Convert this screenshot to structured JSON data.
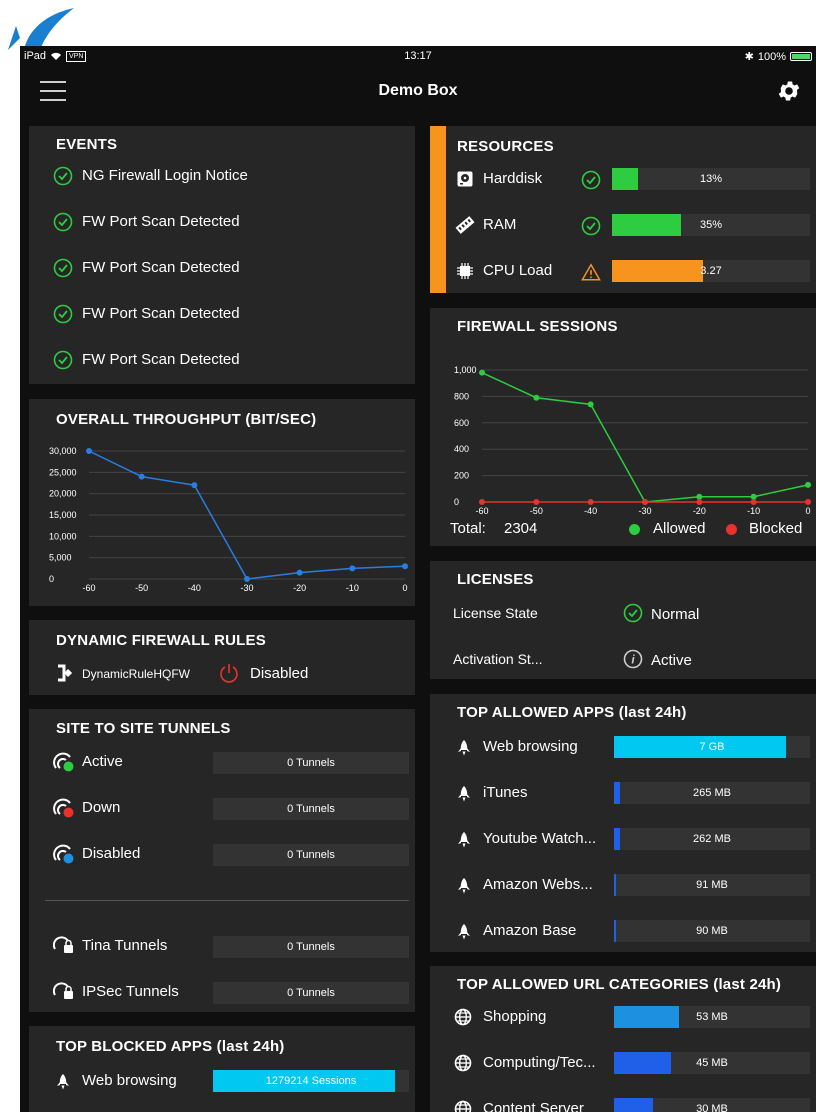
{
  "status_bar": {
    "device": "iPad",
    "vpn": "VPN",
    "time": "13:17",
    "battery": "100%"
  },
  "nav": {
    "title": "Demo Box"
  },
  "events": {
    "title": "EVENTS",
    "items": [
      "NG Firewall Login Notice",
      "FW Port Scan Detected",
      "FW Port Scan Detected",
      "FW Port Scan Detected",
      "FW Port Scan Detected"
    ]
  },
  "resources": {
    "title": "RESOURCES",
    "items": [
      {
        "label": "Harddisk",
        "value": "13%",
        "fraction": 0.13,
        "status": "ok",
        "color": "#2ecc40"
      },
      {
        "label": "RAM",
        "value": "35%",
        "fraction": 0.35,
        "status": "ok",
        "color": "#2ecc40"
      },
      {
        "label": "CPU Load",
        "value": "3.27",
        "fraction": 0.46,
        "status": "warning",
        "color": "#f7941d"
      }
    ],
    "accent_color": "#f7941d"
  },
  "throughput": {
    "title": "OVERALL THROUGHPUT (BIT/SEC)",
    "chart_data": {
      "type": "line",
      "x": [
        -60,
        -50,
        -40,
        -30,
        -20,
        -10,
        0
      ],
      "series": [
        {
          "values": [
            30000,
            24000,
            22000,
            0,
            1500,
            2500,
            3000
          ],
          "color": "#2a7de1"
        }
      ],
      "y_ticks": [
        "30,000",
        "25,000",
        "20,000",
        "15,000",
        "10,000",
        "5,000",
        "0"
      ],
      "x_ticks": [
        "-60",
        "-50",
        "-40",
        "-30",
        "-20",
        "-10",
        "0"
      ],
      "ylim": [
        0,
        30000
      ],
      "grid": true
    }
  },
  "firewall_sessions": {
    "title": "FIREWALL SESSIONS",
    "total_label": "Total:",
    "total_value": "2304",
    "legend_allowed": "Allowed",
    "legend_blocked": "Blocked",
    "chart_data": {
      "type": "line",
      "x": [
        -60,
        -50,
        -40,
        -30,
        -20,
        -10,
        0
      ],
      "series": [
        {
          "name": "Allowed",
          "values": [
            980,
            790,
            740,
            0,
            40,
            40,
            130
          ],
          "color": "#2ecc40"
        },
        {
          "name": "Blocked",
          "values": [
            0,
            0,
            0,
            0,
            0,
            0,
            0
          ],
          "color": "#e8322b"
        }
      ],
      "y_ticks": [
        "1,000",
        "800",
        "600",
        "400",
        "200",
        "0"
      ],
      "x_ticks": [
        "-60",
        "-50",
        "-40",
        "-30",
        "-20",
        "-10",
        "0"
      ],
      "ylim": [
        0,
        1000
      ],
      "grid": true
    }
  },
  "dynamic_rules": {
    "title": "DYNAMIC FIREWALL RULES",
    "rule_name": "DynamicRuleHQFW",
    "rule_status": "Disabled"
  },
  "licenses": {
    "title": "LICENSES",
    "state_label": "License State",
    "state_value": "Normal",
    "activation_label": "Activation St...",
    "activation_value": "Active"
  },
  "site_tunnels": {
    "title": "SITE TO SITE TUNNELS",
    "items": [
      {
        "label": "Active",
        "value": "0 Tunnels"
      },
      {
        "label": "Down",
        "value": "0 Tunnels"
      },
      {
        "label": "Disabled",
        "value": "0 Tunnels"
      },
      {
        "label": "Tina Tunnels",
        "value": "0 Tunnels"
      },
      {
        "label": "IPSec Tunnels",
        "value": "0 Tunnels"
      }
    ]
  },
  "top_apps": {
    "title": "TOP ALLOWED APPS (last 24h)",
    "items": [
      {
        "label": "Web browsing",
        "value": "7 GB",
        "fraction": 0.88,
        "color": "#00c8f0"
      },
      {
        "label": "iTunes",
        "value": "265 MB",
        "fraction": 0.03,
        "color": "#2060e8"
      },
      {
        "label": "Youtube Watch...",
        "value": "262 MB",
        "fraction": 0.03,
        "color": "#2060e8"
      },
      {
        "label": "Amazon Webs...",
        "value": "91 MB",
        "fraction": 0.01,
        "color": "#2060e8"
      },
      {
        "label": "Amazon Base",
        "value": "90 MB",
        "fraction": 0.01,
        "color": "#2060e8"
      }
    ]
  },
  "top_blocked": {
    "title": "TOP BLOCKED APPS (last 24h)",
    "items": [
      {
        "label": "Web browsing",
        "value": "1279214 Sessions",
        "fraction": 0.93,
        "color": "#00c8f0"
      }
    ]
  },
  "top_url": {
    "title": "TOP ALLOWED URL CATEGORIES (last 24h)",
    "items": [
      {
        "label": "Shopping",
        "value": "53 MB",
        "fraction": 0.33,
        "color": "#1e90e0"
      },
      {
        "label": "Computing/Tec...",
        "value": "45 MB",
        "fraction": 0.29,
        "color": "#2060e8"
      },
      {
        "label": "Content Server",
        "value": "30 MB",
        "fraction": 0.2,
        "color": "#2060e8"
      }
    ]
  }
}
